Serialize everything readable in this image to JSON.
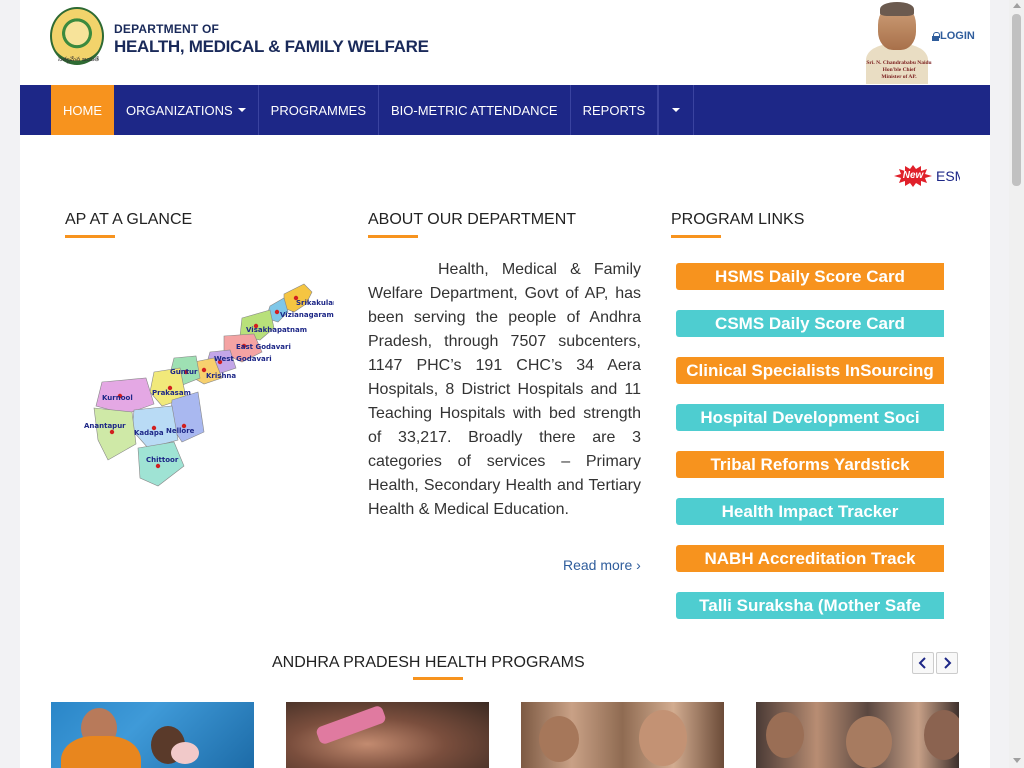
{
  "header": {
    "dept_line1": "DEPARTMENT OF",
    "dept_line2": "HEALTH, MEDICAL & FAMILY WELFARE",
    "emblem_caption": "సత్యమేవ జయతే",
    "cm_caption_line1": "Sri. N. Chandrababu Naidu",
    "cm_caption_line2": "Hon'ble Chief",
    "cm_caption_line3": "Minister of AP.",
    "login_label": "LOGIN",
    "login_icon": "lock-icon"
  },
  "nav": {
    "items": [
      {
        "label": "HOME",
        "active": true
      },
      {
        "label": "ORGANIZATIONS",
        "dropdown": true
      },
      {
        "label": "PROGRAMMES"
      },
      {
        "label": "BIO-METRIC ATTENDANCE"
      },
      {
        "label": "REPORTS"
      }
    ],
    "more_icon": "caret-down-icon"
  },
  "ticker": {
    "badge": "New",
    "text": "ESM"
  },
  "sections": {
    "glance_title": "AP AT A GLANCE",
    "about_title": "ABOUT OUR DEPARTMENT",
    "links_title": "PROGRAM LINKS",
    "programs_title": "ANDHRA PRADESH HEALTH PROGRAMS"
  },
  "map": {
    "districts": [
      "Srikakulam",
      "Vizianagaram",
      "Visakhapatnam",
      "East Godavari",
      "West Godavari",
      "Krishna",
      "Guntur",
      "Prakasam",
      "Nellore",
      "Kurnool",
      "Kadapa",
      "Anantapur",
      "Chittoor"
    ]
  },
  "about": {
    "text": "Health, Medical & Family Welfare Department, Govt of AP, has been serving the people of Andhra Pradesh, through 7507 subcenters, 1147 PHC’s 191 CHC’s 34 Aera Hospitals, 8 District Hospitals and 11 Teaching Hospitals with bed strength of 33,217. Broadly there are 3 categories of services – Primary Health, Secondary Health and Tertiary Health & Medical Education.",
    "read_more": "Read more ›"
  },
  "program_links": [
    {
      "label": "HSMS Daily Score Card",
      "color": "#f7931e"
    },
    {
      "label": "CSMS Daily Score Card",
      "color": "#4ecdd0"
    },
    {
      "label": "Clinical Specialists InSourcing",
      "color": "#f7931e"
    },
    {
      "label": "Hospital Development Soci",
      "color": "#4ecdd0"
    },
    {
      "label": "Tribal Reforms Yardstick",
      "color": "#f7931e"
    },
    {
      "label": "Health Impact Tracker",
      "color": "#4ecdd0"
    },
    {
      "label": "NABH Accreditation Track",
      "color": "#f7931e"
    },
    {
      "label": "Talli Suraksha (Mother Safe",
      "color": "#4ecdd0"
    }
  ],
  "carousel": {
    "prev_icon": "chevron-left-icon",
    "next_icon": "chevron-right-icon"
  },
  "colors": {
    "nav_bg": "#1d2787",
    "accent_orange": "#f7931e",
    "accent_teal": "#4ecdd0",
    "link_blue": "#2f5d9c"
  }
}
